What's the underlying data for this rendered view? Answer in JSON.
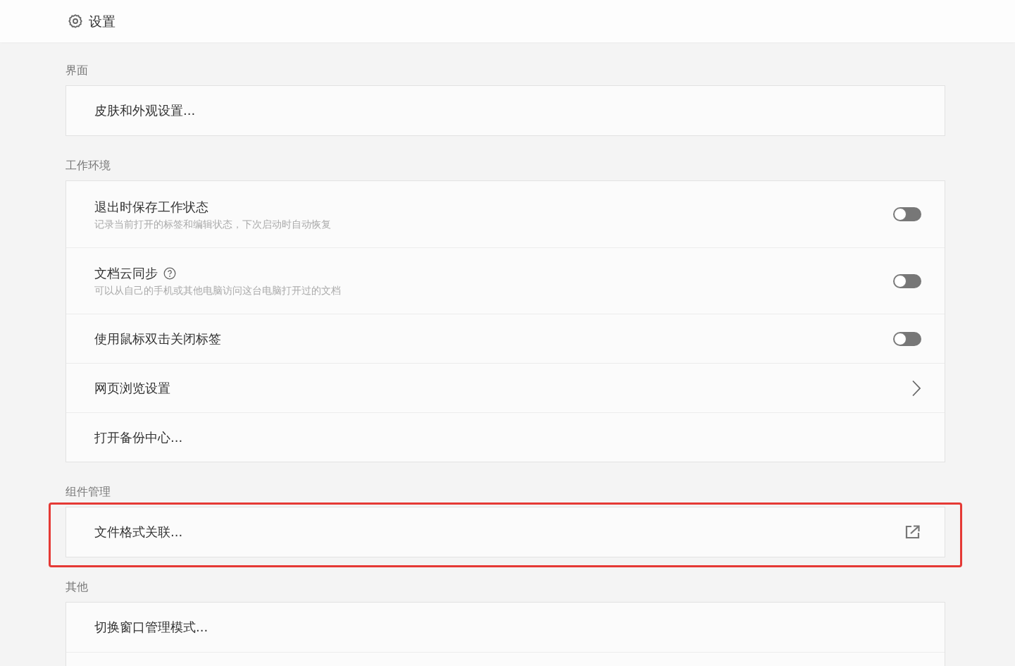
{
  "header": {
    "title": "设置"
  },
  "sections": [
    {
      "label": "界面",
      "highlighted": false,
      "rows": [
        {
          "kind": "plain",
          "title": "皮肤和外观设置..."
        }
      ]
    },
    {
      "label": "工作环境",
      "highlighted": false,
      "rows": [
        {
          "kind": "toggle",
          "title": "退出时保存工作状态",
          "subtitle": "记录当前打开的标签和编辑状态，下次启动时自动恢复",
          "help": false,
          "on": false
        },
        {
          "kind": "toggle",
          "title": "文档云同步",
          "subtitle": "可以从自己的手机或其他电脑访问这台电脑打开过的文档",
          "help": true,
          "on": false
        },
        {
          "kind": "toggle",
          "title": "使用鼠标双击关闭标签",
          "help": false,
          "on": false
        },
        {
          "kind": "link",
          "title": "网页浏览设置"
        },
        {
          "kind": "plain",
          "title": "打开备份中心..."
        }
      ]
    },
    {
      "label": "组件管理",
      "highlighted": true,
      "rows": [
        {
          "kind": "external",
          "title": "文件格式关联..."
        }
      ]
    },
    {
      "label": "其他",
      "highlighted": false,
      "rows": [
        {
          "kind": "plain",
          "title": "切换窗口管理模式..."
        }
      ]
    }
  ]
}
